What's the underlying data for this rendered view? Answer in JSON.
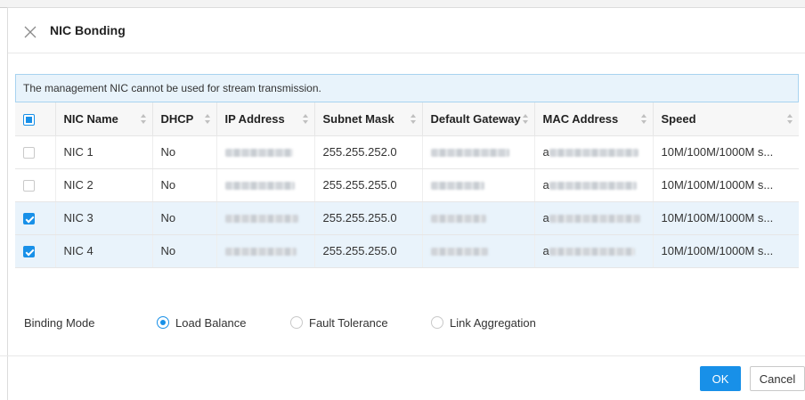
{
  "dialog": {
    "title": "NIC Bonding",
    "close_icon": "close-icon"
  },
  "notice": "The management NIC cannot be used for stream transmission.",
  "table": {
    "columns": [
      "NIC Name",
      "DHCP",
      "IP Address",
      "Subnet Mask",
      "Default Gateway",
      "MAC Address",
      "Speed"
    ],
    "header_checkbox_state": "indeterminate",
    "rows": [
      {
        "nic_name": "NIC 1",
        "dhcp": "No",
        "subnet_mask": "255.255.252.0",
        "mac_prefix": "a",
        "speed": "10M/100M/1000M s...",
        "checked": false
      },
      {
        "nic_name": "NIC 2",
        "dhcp": "No",
        "subnet_mask": "255.255.255.0",
        "mac_prefix": "a",
        "speed": "10M/100M/1000M s...",
        "checked": false
      },
      {
        "nic_name": "NIC 3",
        "dhcp": "No",
        "subnet_mask": "255.255.255.0",
        "mac_prefix": "a",
        "speed": "10M/100M/1000M s...",
        "checked": true
      },
      {
        "nic_name": "NIC 4",
        "dhcp": "No",
        "subnet_mask": "255.255.255.0",
        "mac_prefix": "a",
        "speed": "10M/100M/1000M s...",
        "checked": true
      }
    ]
  },
  "binding_mode": {
    "label": "Binding Mode",
    "options": [
      "Load Balance",
      "Fault Tolerance",
      "Link Aggregation"
    ],
    "selected": "Load Balance"
  },
  "buttons": {
    "ok": "OK",
    "cancel": "Cancel"
  },
  "colors": {
    "accent": "#1890e8",
    "notice_bg": "#e8f3fb",
    "selected_row_bg": "#e9f3fb"
  }
}
